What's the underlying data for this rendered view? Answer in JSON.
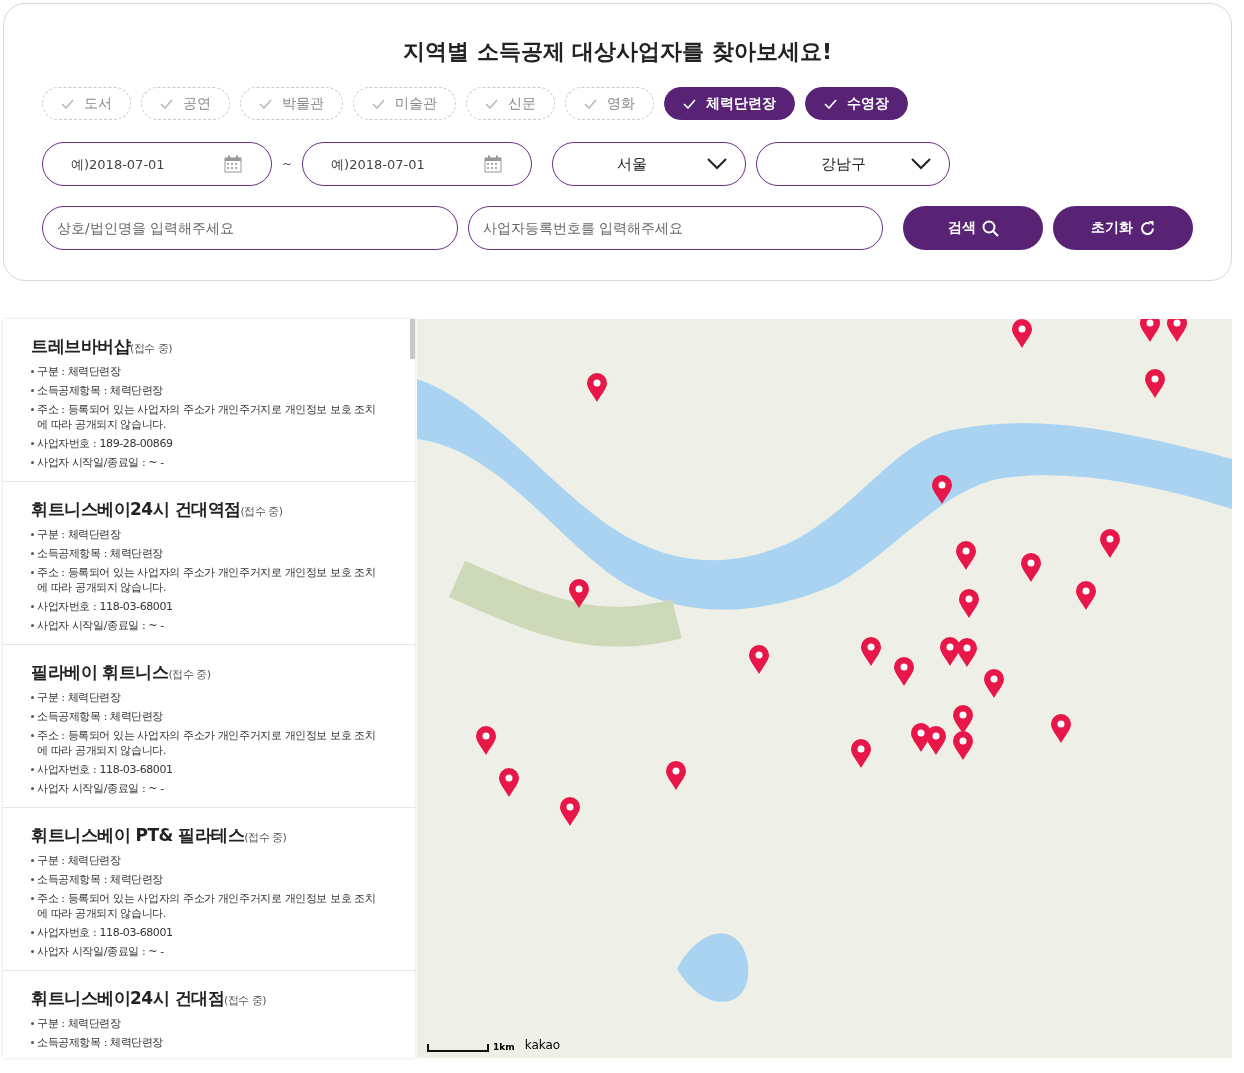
{
  "search_panel": {
    "title": "지역별 소득공제 대상사업자를 찾아보세요!",
    "categories": [
      {
        "label": "도서",
        "selected": false
      },
      {
        "label": "공연",
        "selected": false
      },
      {
        "label": "박물관",
        "selected": false
      },
      {
        "label": "미술관",
        "selected": false
      },
      {
        "label": "신문",
        "selected": false
      },
      {
        "label": "영화",
        "selected": false
      },
      {
        "label": "체력단련장",
        "selected": true
      },
      {
        "label": "수영장",
        "selected": true
      }
    ],
    "start_date": {
      "placeholder": "예)2018-07-01"
    },
    "date_separator": "~",
    "end_date": {
      "placeholder": "예)2018-07-01"
    },
    "region": {
      "value": "서울"
    },
    "district": {
      "value": "강남구"
    },
    "name_field": {
      "placeholder": "상호/법인명을 입력해주세요"
    },
    "registration_field": {
      "placeholder": "사업자등록번호를 입력해주세요"
    },
    "search_button": "검색",
    "reset_button": "초기화"
  },
  "results": [
    {
      "name": "트레브바버샵",
      "status": "(접수 중)",
      "details": [
        "구분 : 체력단련장",
        "소득공제항목 : 체력단련장",
        "주소 : 등록되어 있는 사업자의 주소가 개인주거지로 개인정보 보호 조치에 따라 공개되지 않습니다.",
        "사업자번호 : 189-28-00869",
        "사업자 시작일/종료일 :  ~ -"
      ]
    },
    {
      "name": "휘트니스베이24시 건대역점",
      "status": "(접수 중)",
      "details": [
        "구분 : 체력단련장",
        "소득공제항목 : 체력단련장",
        "주소 : 등록되어 있는 사업자의 주소가 개인주거지로 개인정보 보호 조치에 따라 공개되지 않습니다.",
        "사업자번호 : 118-03-68001",
        "사업자 시작일/종료일 :  ~ -"
      ]
    },
    {
      "name": "필라베이 휘트니스",
      "status": "(접수 중)",
      "details": [
        "구분 : 체력단련장",
        "소득공제항목 : 체력단련장",
        "주소 : 등록되어 있는 사업자의 주소가 개인주거지로 개인정보 보호 조치에 따라 공개되지 않습니다.",
        "사업자번호 : 118-03-68001",
        "사업자 시작일/종료일 :  ~ -"
      ]
    },
    {
      "name": "휘트니스베이 PT& 필라테스",
      "status": "(접수 중)",
      "details": [
        "구분 : 체력단련장",
        "소득공제항목 : 체력단련장",
        "주소 : 등록되어 있는 사업자의 주소가 개인주거지로 개인정보 보호 조치에 따라 공개되지 않습니다.",
        "사업자번호 : 118-03-68001",
        "사업자 시작일/종료일 :  ~ -"
      ]
    },
    {
      "name": "휘트니스베이24시 건대점",
      "status": "(접수 중)",
      "details": [
        "구분 : 체력단련장",
        "소득공제항목 : 체력단련장"
      ]
    }
  ],
  "map": {
    "scale": "1km",
    "logo": "kakao"
  }
}
